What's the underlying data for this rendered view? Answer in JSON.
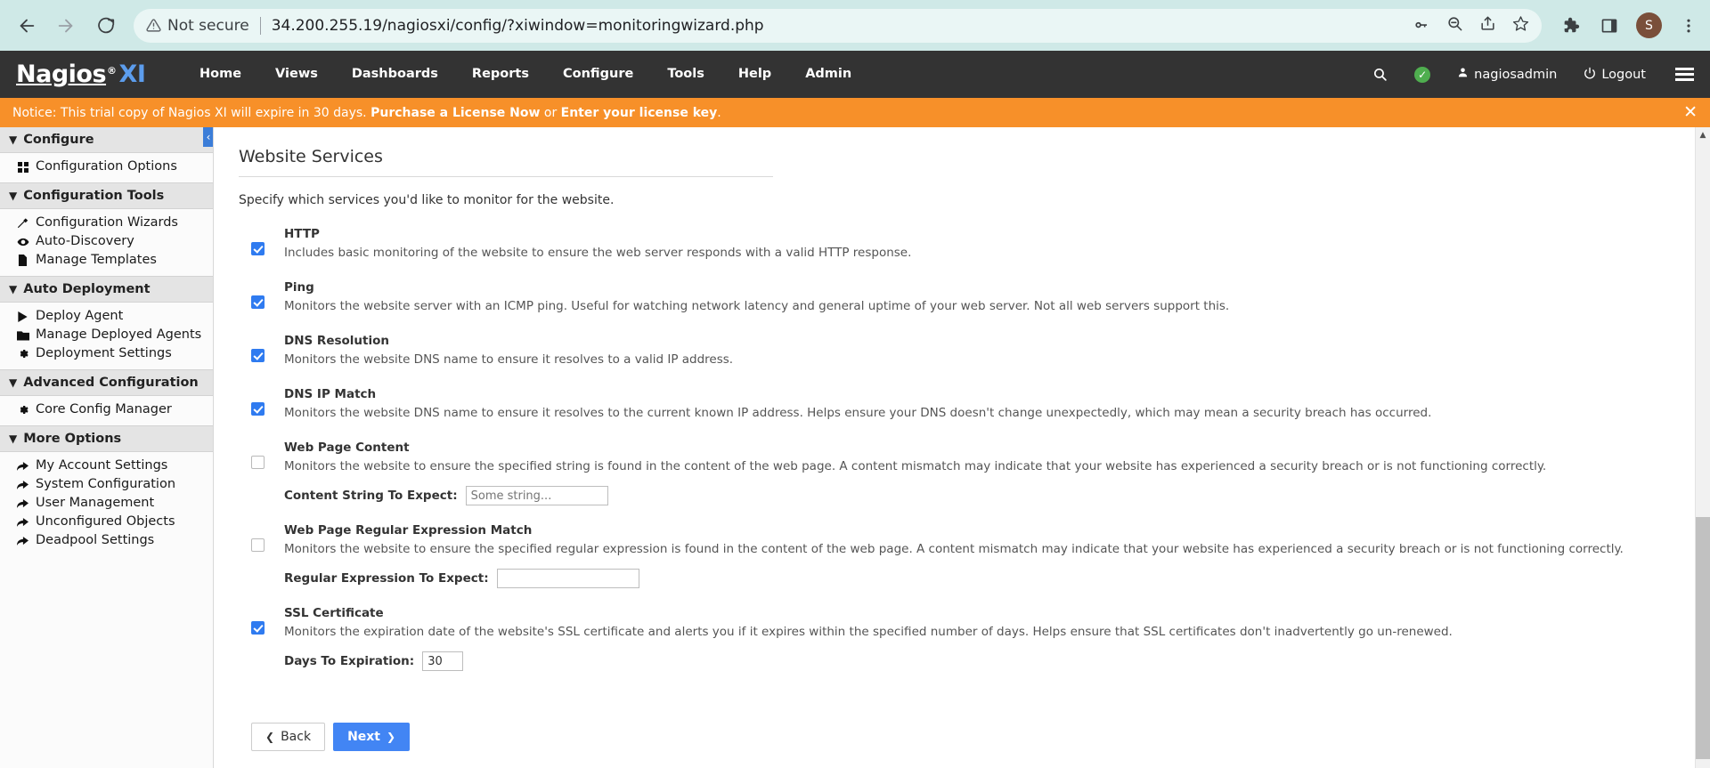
{
  "browser": {
    "back_icon": "arrow-left-icon",
    "forward_icon": "arrow-right-icon",
    "reload_icon": "reload-icon",
    "security_icon": "warning-triangle-icon",
    "security_label": "Not secure",
    "url": "34.200.255.19/nagiosxi/config/?xiwindow=monitoringwizard.php",
    "omnibox_icons": [
      "key-icon",
      "zoom-out-icon",
      "share-icon",
      "bookmark-star-icon"
    ],
    "toolbar_icons": [
      "extensions-puzzle-icon",
      "side-panel-icon"
    ],
    "avatar_initial": "S",
    "menu_icon": "three-dot-menu-icon"
  },
  "header": {
    "logo": {
      "word": "Nagios",
      "registered": "®",
      "suffix": "XI"
    },
    "nav": [
      {
        "label": "Home"
      },
      {
        "label": "Views"
      },
      {
        "label": "Dashboards"
      },
      {
        "label": "Reports"
      },
      {
        "label": "Configure"
      },
      {
        "label": "Tools"
      },
      {
        "label": "Help"
      },
      {
        "label": "Admin"
      }
    ],
    "search_icon": "search-icon",
    "status_icon": "green-check-circle-icon",
    "user_icon": "user-icon",
    "username": "nagiosadmin",
    "logout_icon": "power-icon",
    "logout_label": "Logout",
    "menu_icon": "hamburger-menu-icon"
  },
  "notice": {
    "text_before": "Notice: This trial copy of Nagios XI will expire in 30 days.",
    "link1": "Purchase a License Now",
    "between": "or",
    "link2": "Enter your license key",
    "text_after": ".",
    "close_icon": "close-icon",
    "background": "#f79029"
  },
  "sidebar": {
    "sections": [
      {
        "title": "Configure",
        "items": [
          {
            "label": "Configuration Options",
            "icon": "grid-icon",
            "glyph": "▒"
          }
        ]
      },
      {
        "title": "Configuration Tools",
        "items": [
          {
            "label": "Configuration Wizards",
            "icon": "magic-wand-icon",
            "glyph": "✐"
          },
          {
            "label": "Auto-Discovery",
            "icon": "eye-icon",
            "glyph": "◉"
          },
          {
            "label": "Manage Templates",
            "icon": "file-icon",
            "glyph": "▮"
          }
        ]
      },
      {
        "title": "Auto Deployment",
        "items": [
          {
            "label": "Deploy Agent",
            "icon": "play-triangle-icon",
            "glyph": "▶"
          },
          {
            "label": "Manage Deployed Agents",
            "icon": "folder-icon",
            "glyph": "▬"
          },
          {
            "label": "Deployment Settings",
            "icon": "gear-icon",
            "glyph": "⚙"
          }
        ]
      },
      {
        "title": "Advanced Configuration",
        "items": [
          {
            "label": "Core Config Manager",
            "icon": "gear-icon",
            "glyph": "⚙"
          }
        ]
      },
      {
        "title": "More Options",
        "items": [
          {
            "label": "My Account Settings",
            "icon": "arrow-curve-icon",
            "glyph": "➦"
          },
          {
            "label": "System Configuration",
            "icon": "arrow-curve-icon",
            "glyph": "➦"
          },
          {
            "label": "User Management",
            "icon": "arrow-curve-icon",
            "glyph": "➦"
          },
          {
            "label": "Unconfigured Objects",
            "icon": "arrow-curve-icon",
            "glyph": "➦"
          },
          {
            "label": "Deadpool Settings",
            "icon": "arrow-curve-icon",
            "glyph": "➦"
          }
        ]
      }
    ],
    "collapse_handle_glyph": "‹"
  },
  "main": {
    "title": "Website Services",
    "intro": "Specify which services you'd like to monitor for the website.",
    "services": [
      {
        "name": "HTTP",
        "checked": true,
        "description": "Includes basic monitoring of the website to ensure the web server responds with a valid HTTP response."
      },
      {
        "name": "Ping",
        "checked": true,
        "description": "Monitors the website server with an ICMP ping. Useful for watching network latency and general uptime of your web server. Not all web servers support this."
      },
      {
        "name": "DNS Resolution",
        "checked": true,
        "description": "Monitors the website DNS name to ensure it resolves to a valid IP address."
      },
      {
        "name": "DNS IP Match",
        "checked": true,
        "description": "Monitors the website DNS name to ensure it resolves to the current known IP address. Helps ensure your DNS doesn't change unexpectedly, which may mean a security breach has occurred."
      },
      {
        "name": "Web Page Content",
        "checked": false,
        "description": "Monitors the website to ensure the specified string is found in the content of the web page. A content mismatch may indicate that your website has experienced a security breach or is not functioning correctly.",
        "field_label": "Content String To Expect:",
        "field_value": "",
        "field_placeholder": "Some string..."
      },
      {
        "name": "Web Page Regular Expression Match",
        "checked": false,
        "description": "Monitors the website to ensure the specified regular expression is found in the content of the web page. A content mismatch may indicate that your website has experienced a security breach or is not functioning correctly.",
        "field_label": "Regular Expression To Expect:",
        "field_value": "",
        "field_placeholder": ""
      },
      {
        "name": "SSL Certificate",
        "checked": true,
        "description": "Monitors the expiration date of the website's SSL certificate and alerts you if it expires within the specified number of days. Helps ensure that SSL certificates don't inadvertently go un-renewed.",
        "field_label": "Days To Expiration:",
        "field_value": "30",
        "field_placeholder": ""
      }
    ],
    "back_button": {
      "label": "Back",
      "icon": "chevron-left-icon",
      "glyph": "❮"
    },
    "next_button": {
      "label": "Next",
      "icon": "chevron-right-icon",
      "glyph": "❯"
    }
  },
  "colors": {
    "accent_blue": "#4285f4",
    "checkbox_blue": "#2f7bf0",
    "notice_orange": "#f79029",
    "header_dark": "#333333",
    "logo_blue": "#5c9ded"
  }
}
